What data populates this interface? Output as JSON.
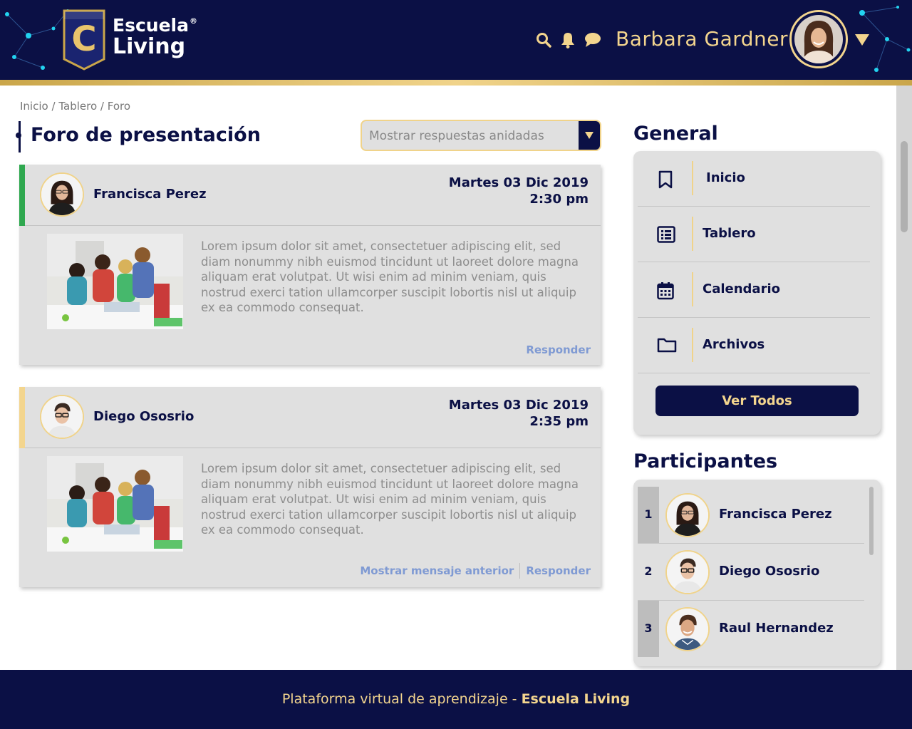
{
  "brand": {
    "line1": "Escuela",
    "line2": "Living",
    "mark": "®",
    "logo_letter": "C"
  },
  "colors": {
    "navy": "#0b1045",
    "gold": "#f3d58e",
    "panel": "#e0e0e0",
    "link": "#7f9ad3",
    "green": "#2fa84f"
  },
  "header": {
    "icons": [
      "search-icon",
      "bell-icon",
      "chat-icon"
    ],
    "user_name": "Barbara Gardner"
  },
  "breadcrumb": {
    "items": [
      "Inicio",
      "Tablero",
      "Foro"
    ],
    "separator": "/"
  },
  "forum": {
    "title": "Foro de presentación",
    "view_select": {
      "value": "Mostrar respuestas anidadas"
    },
    "posts": [
      {
        "author": "Francisca Perez",
        "date": "Martes 03 Dic 2019",
        "time": "2:30 pm",
        "body": "Lorem ipsum dolor sit amet, consectetuer adipiscing elit, sed diam nonummy nibh euismod tincidunt ut laoreet dolore magna aliquam erat volutpat. Ut wisi enim ad minim veniam, quis nostrud exerci tation ullamcorper suscipit lobortis nisl ut aliquip ex ea commodo consequat.",
        "actions": [
          "Responder"
        ]
      },
      {
        "author": "Diego Ososrio",
        "date": "Martes 03 Dic 2019",
        "time": "2:35 pm",
        "body": "Lorem ipsum dolor sit amet, consectetuer adipiscing elit, sed diam nonummy nibh euismod tincidunt ut laoreet dolore magna aliquam erat volutpat. Ut wisi enim ad minim veniam, quis nostrud exerci tation ullamcorper suscipit lobortis nisl ut aliquip ex ea commodo consequat.",
        "actions": [
          "Mostrar mensaje anterior",
          "Responder"
        ]
      }
    ]
  },
  "general": {
    "title": "General",
    "items": [
      {
        "label": "Inicio",
        "icon": "bookmark-icon"
      },
      {
        "label": "Tablero",
        "icon": "list-icon"
      },
      {
        "label": "Calendario",
        "icon": "calendar-icon"
      },
      {
        "label": "Archivos",
        "icon": "folder-icon"
      }
    ],
    "button": "Ver Todos"
  },
  "participants": {
    "title": "Participantes",
    "items": [
      {
        "num": "1",
        "name": "Francisca Perez"
      },
      {
        "num": "2",
        "name": "Diego Ososrio"
      },
      {
        "num": "3",
        "name": "Raul Hernandez"
      }
    ]
  },
  "footer": {
    "text": "Plataforma virtual de aprendizaje - ",
    "brand": "Escuela Living"
  }
}
